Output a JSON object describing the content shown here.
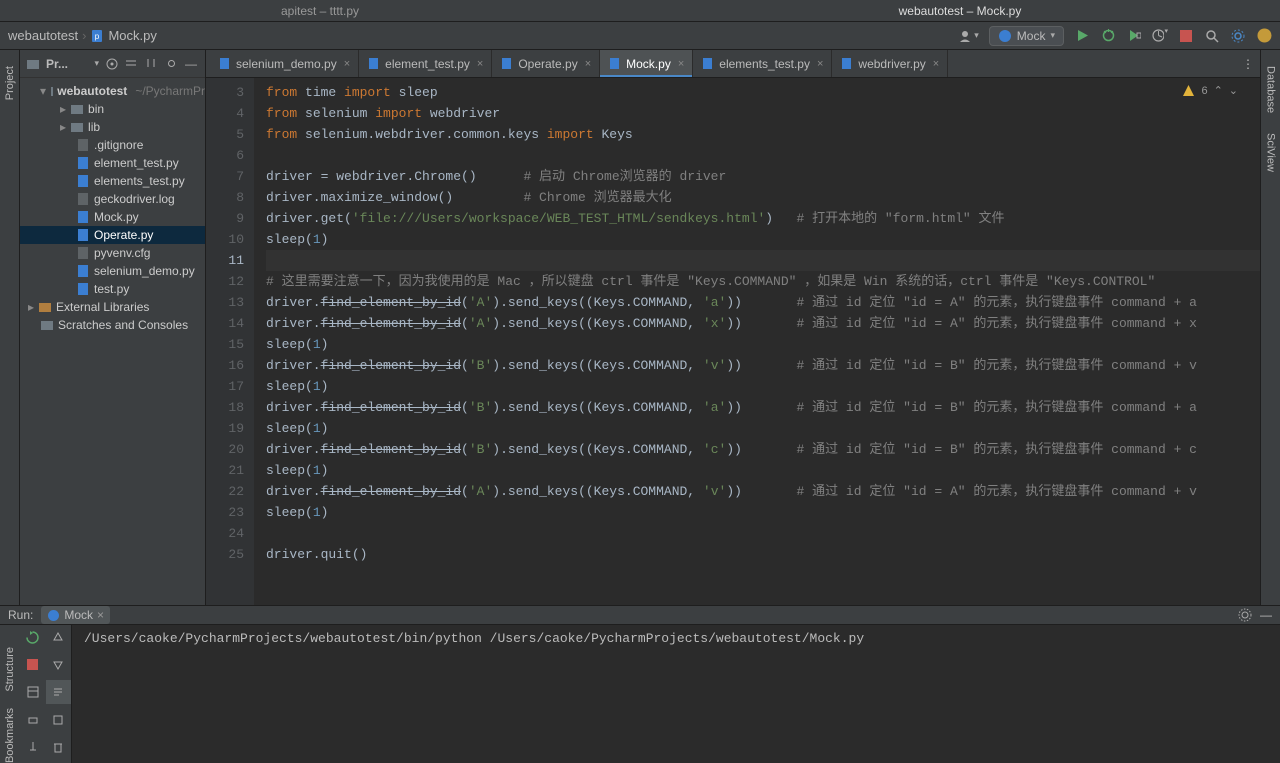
{
  "title_inactive": "apitest – tttt.py",
  "title_active": "webautotest – Mock.py",
  "breadcrumb": {
    "project": "webautotest",
    "file": "Mock.py"
  },
  "toolbar": {
    "run_config": "Mock"
  },
  "project_panel": {
    "title": "Pr..."
  },
  "tree": {
    "root": "webautotest",
    "root_hint": "~/PycharmPr",
    "bin": "bin",
    "lib": "lib",
    "gitignore": ".gitignore",
    "element_test": "element_test.py",
    "elements_test": "elements_test.py",
    "geckodriver": "geckodriver.log",
    "mock": "Mock.py",
    "operate": "Operate.py",
    "pyvenv": "pyvenv.cfg",
    "selenium_demo": "selenium_demo.py",
    "test": "test.py",
    "external": "External Libraries",
    "scratches": "Scratches and Consoles"
  },
  "tabs": [
    {
      "label": "selenium_demo.py"
    },
    {
      "label": "element_test.py"
    },
    {
      "label": "Operate.py"
    },
    {
      "label": "Mock.py"
    },
    {
      "label": "elements_test.py"
    },
    {
      "label": "webdriver.py"
    }
  ],
  "warnings_badge": "6",
  "code": {
    "l3": {
      "a": "from",
      "b": " time ",
      "c": "import",
      "d": " sleep"
    },
    "l4": {
      "a": "from",
      "b": " selenium ",
      "c": "import",
      "d": " webdriver"
    },
    "l5": {
      "a": "from",
      "b": " selenium.webdriver.common.keys ",
      "c": "import",
      "d": " Keys"
    },
    "l7": {
      "a": "driver = webdriver.Chrome()      ",
      "c": "# 启动 Chrome浏览器的 driver"
    },
    "l8": {
      "a": "driver.maximize_window()         ",
      "c": "# Chrome 浏览器最大化"
    },
    "l9": {
      "a": "driver.get(",
      "s": "'file:///Users/workspace/WEB_TEST_HTML/sendkeys.html'",
      "b": ")   ",
      "c": "# 打开本地的 \"form.html\" 文件"
    },
    "l10": {
      "a": "sleep(",
      "n": "1",
      "b": ")"
    },
    "l12": {
      "c": "# 这里需要注意一下，因为我使用的是 Mac ，所以键盘 ctrl 事件是 \"Keys.COMMAND\" ，如果是 Win 系统的话，ctrl 事件是 \"Keys.CONTROL\""
    },
    "l13": {
      "a": "driver.",
      "m": "find_element_by_id",
      "b": "(",
      "s1": "'A'",
      "c1": ").send_keys((Keys.COMMAND, ",
      "s2": "'a'",
      "d": "))       ",
      "cm": "# 通过 id 定位 \"id = A\" 的元素，执行键盘事件 command + a"
    },
    "l14": {
      "a": "driver.",
      "m": "find_element_by_id",
      "b": "(",
      "s1": "'A'",
      "c1": ").send_keys((Keys.COMMAND, ",
      "s2": "'x'",
      "d": "))       ",
      "cm": "# 通过 id 定位 \"id = A\" 的元素，执行键盘事件 command + x"
    },
    "l15": {
      "a": "sleep(",
      "n": "1",
      "b": ")"
    },
    "l16": {
      "a": "driver.",
      "m": "find_element_by_id",
      "b": "(",
      "s1": "'B'",
      "c1": ").send_keys((Keys.COMMAND, ",
      "s2": "'v'",
      "d": "))       ",
      "cm": "# 通过 id 定位 \"id = B\" 的元素，执行键盘事件 command + v"
    },
    "l17": {
      "a": "sleep(",
      "n": "1",
      "b": ")"
    },
    "l18": {
      "a": "driver.",
      "m": "find_element_by_id",
      "b": "(",
      "s1": "'B'",
      "c1": ").send_keys((Keys.COMMAND, ",
      "s2": "'a'",
      "d": "))       ",
      "cm": "# 通过 id 定位 \"id = B\" 的元素，执行键盘事件 command + a"
    },
    "l19": {
      "a": "sleep(",
      "n": "1",
      "b": ")"
    },
    "l20": {
      "a": "driver.",
      "m": "find_element_by_id",
      "b": "(",
      "s1": "'B'",
      "c1": ").send_keys((Keys.COMMAND, ",
      "s2": "'c'",
      "d": "))       ",
      "cm": "# 通过 id 定位 \"id = B\" 的元素，执行键盘事件 command + c"
    },
    "l21": {
      "a": "sleep(",
      "n": "1",
      "b": ")"
    },
    "l22": {
      "a": "driver.",
      "m": "find_element_by_id",
      "b": "(",
      "s1": "'A'",
      "c1": ").send_keys((Keys.COMMAND, ",
      "s2": "'v'",
      "d": "))       ",
      "cm": "# 通过 id 定位 \"id = A\" 的元素，执行键盘事件 command + v"
    },
    "l23": {
      "a": "sleep(",
      "n": "1",
      "b": ")"
    },
    "l25": {
      "a": "driver.quit()"
    }
  },
  "run_panel": {
    "label": "Run:",
    "config": "Mock",
    "output": "/Users/caoke/PycharmProjects/webautotest/bin/python /Users/caoke/PycharmProjects/webautotest/Mock.py"
  },
  "left_rail": {
    "structure": "Structure",
    "bookmarks": "Bookmarks",
    "project": "Project"
  },
  "right_rail": {
    "database": "Database",
    "sciview": "SciView"
  }
}
